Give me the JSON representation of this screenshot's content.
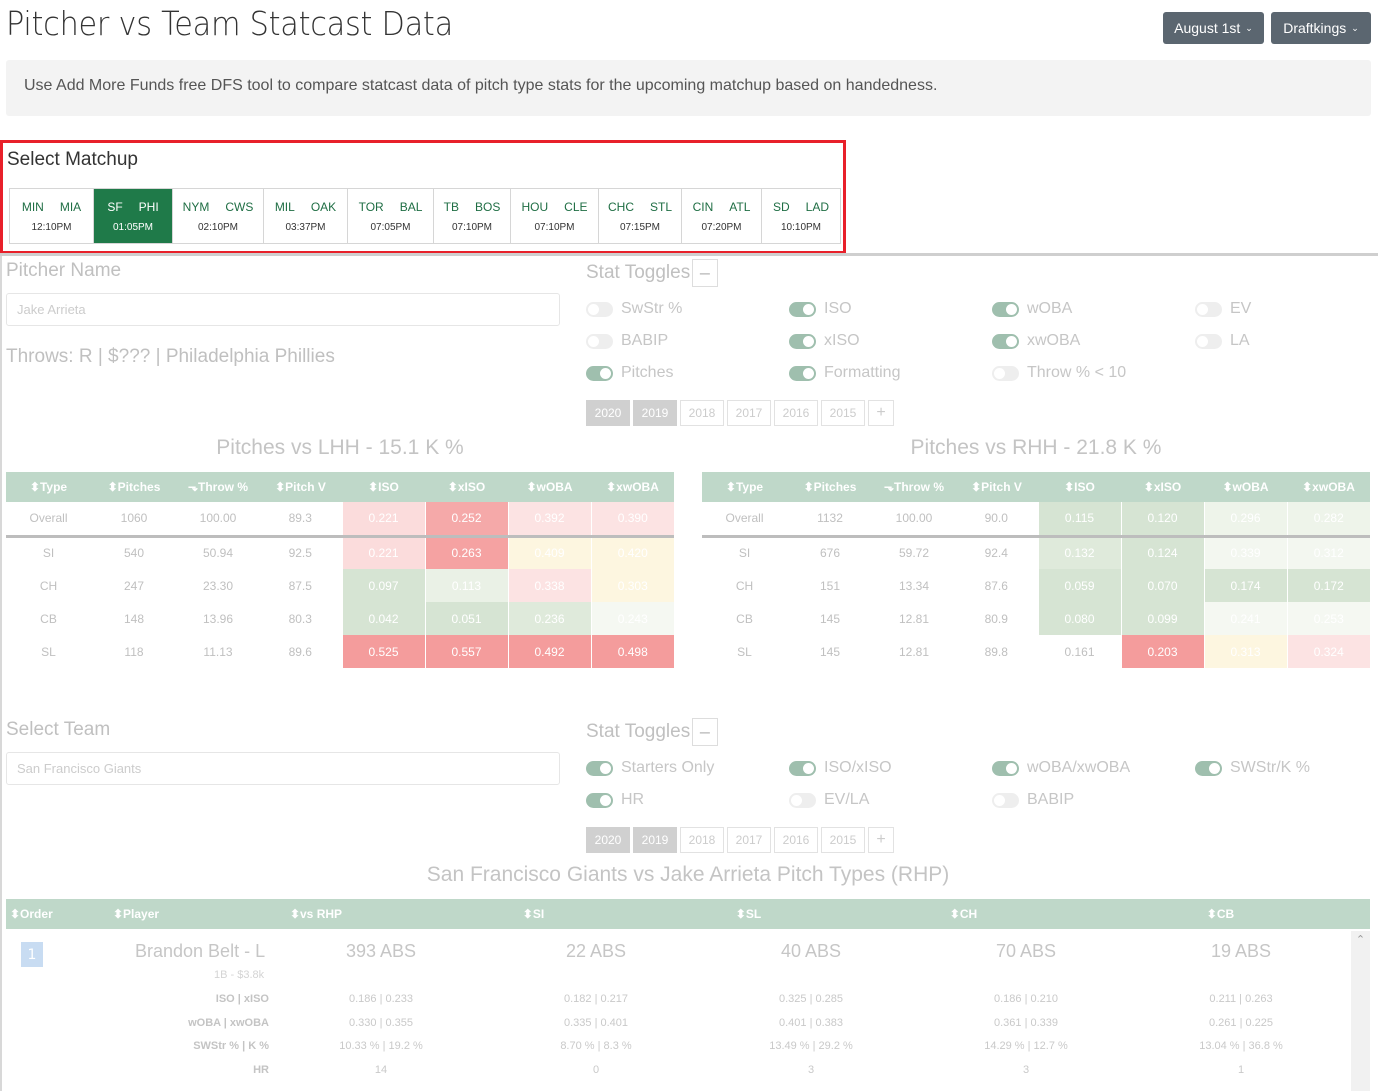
{
  "header": {
    "title": "Pitcher vs Team Statcast Data",
    "date_label": "August 1st",
    "site_label": "Draftkings",
    "intro": "Use Add More Funds free DFS tool to compare statcast data of pitch type stats for the upcoming matchup based on handedness."
  },
  "matchups": {
    "title": "Select Matchup",
    "games": [
      {
        "away": "MIN",
        "home": "MIA",
        "time": "12:10PM"
      },
      {
        "away": "SF",
        "home": "PHI",
        "time": "01:05PM"
      },
      {
        "away": "NYM",
        "home": "CWS",
        "time": "02:10PM"
      },
      {
        "away": "MIL",
        "home": "OAK",
        "time": "03:37PM"
      },
      {
        "away": "TOR",
        "home": "BAL",
        "time": "07:05PM"
      },
      {
        "away": "TB",
        "home": "BOS",
        "time": "07:10PM"
      },
      {
        "away": "HOU",
        "home": "CLE",
        "time": "07:10PM"
      },
      {
        "away": "CHC",
        "home": "STL",
        "time": "07:15PM"
      },
      {
        "away": "CIN",
        "home": "ATL",
        "time": "07:20PM"
      },
      {
        "away": "SD",
        "home": "LAD",
        "time": "10:10PM"
      }
    ]
  },
  "pitcher": {
    "label": "Pitcher Name",
    "value": "Jake Arrieta",
    "throws": "Throws: R | $??? | Philadelphia Phillies"
  },
  "pitcher_toggles": {
    "title": "Stat Toggles",
    "minus": "−",
    "items": [
      {
        "label": "SwStr %",
        "on": false
      },
      {
        "label": "ISO",
        "on": true
      },
      {
        "label": "wOBA",
        "on": true
      },
      {
        "label": "EV",
        "on": false
      },
      {
        "label": "BABIP",
        "on": false
      },
      {
        "label": "xISO",
        "on": true
      },
      {
        "label": "xwOBA",
        "on": true
      },
      {
        "label": "LA",
        "on": false
      },
      {
        "label": "Pitches",
        "on": true
      },
      {
        "label": "Formatting",
        "on": true
      },
      {
        "label": "Throw % < 10",
        "on": false
      }
    ],
    "years": [
      "2020",
      "2019",
      "2018",
      "2017",
      "2016",
      "2015",
      "+"
    ]
  },
  "lhh": {
    "title": "Pitches vs LHH - 15.1 K %",
    "headers": [
      "⬍Type",
      "⬍Pitches",
      "⬎Throw %",
      "⬍Pitch V",
      "⬍ISO",
      "⬍xISO",
      "⬍wOBA",
      "⬍xwOBA"
    ],
    "rows": [
      {
        "cells": [
          "Overall",
          "1060",
          "100.00",
          "89.3",
          "0.221",
          "0.252",
          "0.392",
          "0.390"
        ],
        "colors": [
          "",
          "",
          "",
          "",
          "#fbdcdc",
          "#f5a9a9",
          "#fce3e3",
          "#fce3e3"
        ]
      },
      {
        "cells": [
          "SI",
          "540",
          "50.94",
          "92.5",
          "0.221",
          "0.263",
          "0.409",
          "0.420"
        ],
        "colors": [
          "",
          "",
          "",
          "",
          "#fbdcdc",
          "#f5a2a2",
          "#fdf6e0",
          "#fdf6e0"
        ]
      },
      {
        "cells": [
          "CH",
          "247",
          "23.30",
          "87.5",
          "0.097",
          "0.113",
          "0.338",
          "0.303"
        ],
        "colors": [
          "",
          "",
          "",
          "",
          "#d6e4d3",
          "#eaf1e6",
          "#fce3e3",
          "#fdf6e0"
        ]
      },
      {
        "cells": [
          "CB",
          "148",
          "13.96",
          "80.3",
          "0.042",
          "0.051",
          "0.236",
          "0.243"
        ],
        "colors": [
          "",
          "",
          "",
          "",
          "#d6e4d3",
          "#d6e4d3",
          "#dfeadb",
          "#f5f8f2"
        ]
      },
      {
        "cells": [
          "SL",
          "118",
          "11.13",
          "89.6",
          "0.525",
          "0.557",
          "0.492",
          "0.498"
        ],
        "colors": [
          "",
          "",
          "",
          "",
          "#f49c9c",
          "#f49c9c",
          "#f49c9c",
          "#f49c9c"
        ]
      }
    ]
  },
  "rhh": {
    "title": "Pitches vs RHH - 21.8 K %",
    "headers": [
      "⬍Type",
      "⬍Pitches",
      "⬎Throw %",
      "⬍Pitch V",
      "⬍ISO",
      "⬍xISO",
      "⬍wOBA",
      "⬍xwOBA"
    ],
    "rows": [
      {
        "cells": [
          "Overall",
          "1132",
          "100.00",
          "90.0",
          "0.115",
          "0.120",
          "0.296",
          "0.282"
        ],
        "colors": [
          "",
          "",
          "",
          "",
          "#d6e4d3",
          "#d6e4d3",
          "#eef4ea",
          "#eef4ea"
        ]
      },
      {
        "cells": [
          "SI",
          "676",
          "59.72",
          "92.4",
          "0.132",
          "0.124",
          "0.339",
          "0.312"
        ],
        "colors": [
          "",
          "",
          "",
          "",
          "#dfeadb",
          "#d6e4d3",
          "#f3f7f0",
          "#f3f7f0"
        ]
      },
      {
        "cells": [
          "CH",
          "151",
          "13.34",
          "87.6",
          "0.059",
          "0.070",
          "0.174",
          "0.172"
        ],
        "colors": [
          "",
          "",
          "",
          "",
          "#d6e4d3",
          "#d6e4d3",
          "#d6e4d3",
          "#d6e4d3"
        ]
      },
      {
        "cells": [
          "CB",
          "145",
          "12.81",
          "80.9",
          "0.080",
          "0.099",
          "0.241",
          "0.253"
        ],
        "colors": [
          "",
          "",
          "",
          "",
          "#d6e4d3",
          "#d6e4d3",
          "#f5f8f2",
          "#f5f8f2"
        ]
      },
      {
        "cells": [
          "SL",
          "145",
          "12.81",
          "89.8",
          "0.161",
          "0.203",
          "0.313",
          "0.324"
        ],
        "colors": [
          "",
          "",
          "",
          "",
          "",
          "#f49c9c",
          "#fdf6e0",
          "#fce3e3"
        ]
      }
    ]
  },
  "team": {
    "label": "Select Team",
    "value": "San Francisco Giants"
  },
  "team_toggles": {
    "title": "Stat Toggles",
    "minus": "−",
    "items": [
      {
        "label": "Starters Only",
        "on": true
      },
      {
        "label": "ISO/xISO",
        "on": true
      },
      {
        "label": "wOBA/xwOBA",
        "on": true
      },
      {
        "label": "SWStr/K %",
        "on": true
      },
      {
        "label": "HR",
        "on": true
      },
      {
        "label": "EV/LA",
        "on": false
      },
      {
        "label": "BABIP",
        "on": false
      }
    ],
    "years": [
      "2020",
      "2019",
      "2018",
      "2017",
      "2016",
      "2015",
      "+"
    ]
  },
  "lineup": {
    "title": "San Francisco Giants vs Jake Arrieta Pitch Types (RHP)",
    "headers": [
      "⬍Order",
      "⬍Player",
      "⬍vs RHP",
      "⬍SI",
      "⬍SL",
      "⬍CH",
      "⬍CB"
    ],
    "player": {
      "order": "1",
      "name": "Brandon Belt - L",
      "sub": "1B - $3.8k",
      "abs": [
        "393 ABS",
        "22 ABS",
        "40 ABS",
        "70 ABS",
        "19 ABS"
      ],
      "stats": [
        {
          "label": "ISO | xISO",
          "values": [
            "0.186 | 0.233",
            "0.182 | 0.217",
            "0.325 | 0.285",
            "0.186 | 0.210",
            "0.211 | 0.263"
          ]
        },
        {
          "label": "wOBA | xwOBA",
          "values": [
            "0.330 | 0.355",
            "0.335 | 0.401",
            "0.401 | 0.383",
            "0.361 | 0.339",
            "0.261 | 0.225"
          ]
        },
        {
          "label": "SWStr % | K %",
          "values": [
            "10.33 % | 19.2 %",
            "8.70 % | 8.3 %",
            "13.49 % | 29.2 %",
            "14.29 % | 12.7 %",
            "13.04 % | 36.8 %"
          ]
        },
        {
          "label": "HR",
          "values": [
            "14",
            "0",
            "3",
            "3",
            "1"
          ]
        }
      ]
    }
  },
  "colors": {
    "accent_green": "#1f7a49",
    "header_green": "#bfd8c9",
    "highlight_red": "#e8202a",
    "button_gray": "#5b6670"
  }
}
